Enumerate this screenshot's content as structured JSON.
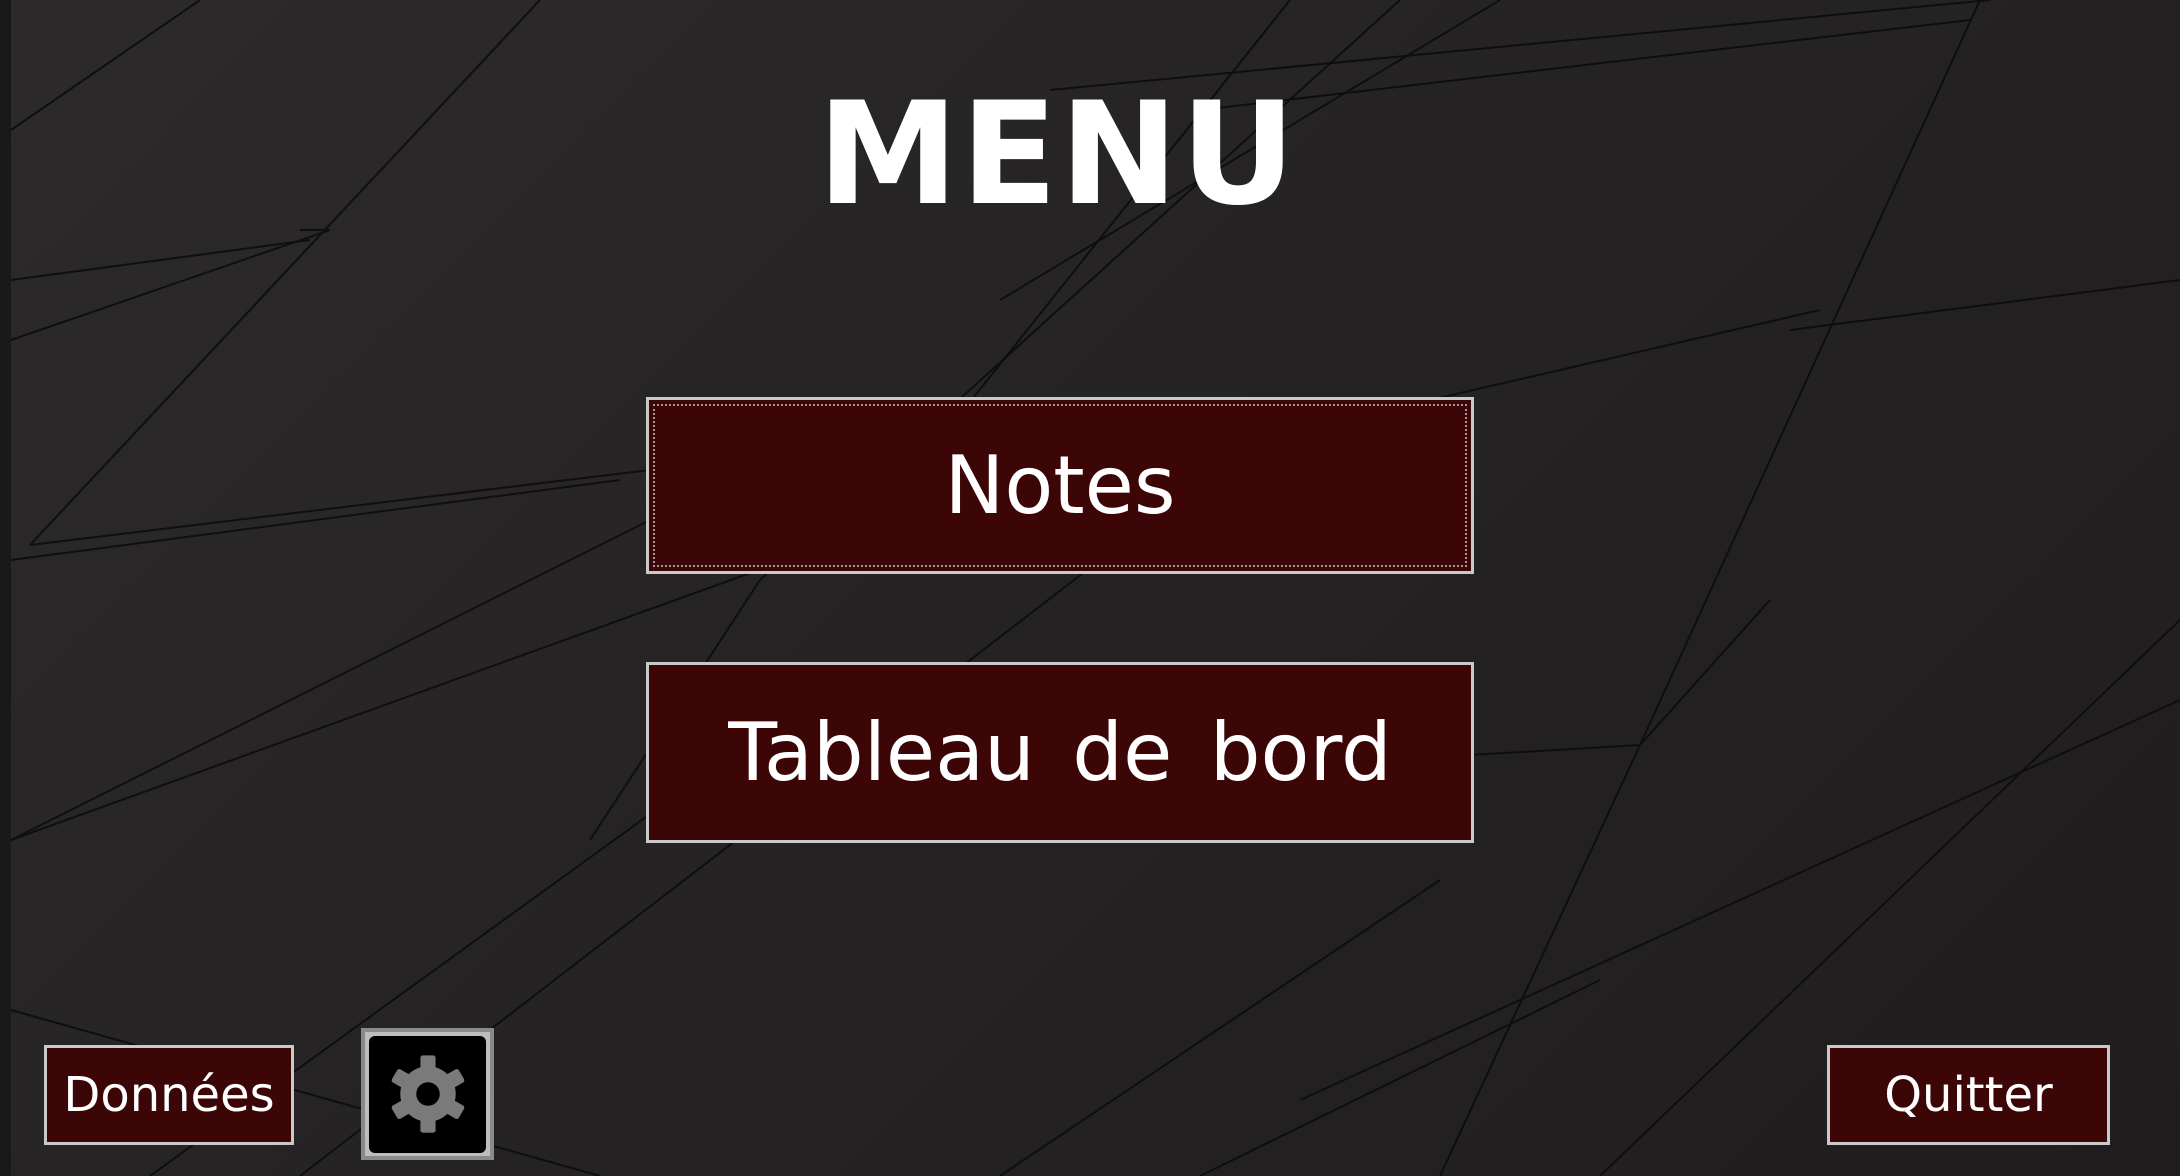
{
  "menu": {
    "title": "MENU",
    "buttons": {
      "notes": "Notes",
      "tableau_de_bord": "Tableau de bord"
    }
  },
  "footer": {
    "donnees_label": "Données",
    "quitter_label": "Quitter",
    "settings_icon": "gear-icon"
  },
  "colors": {
    "button_fill": "#3c0607",
    "button_border": "#c9c9c9",
    "background": "#262424",
    "title_text": "#ffffff"
  }
}
